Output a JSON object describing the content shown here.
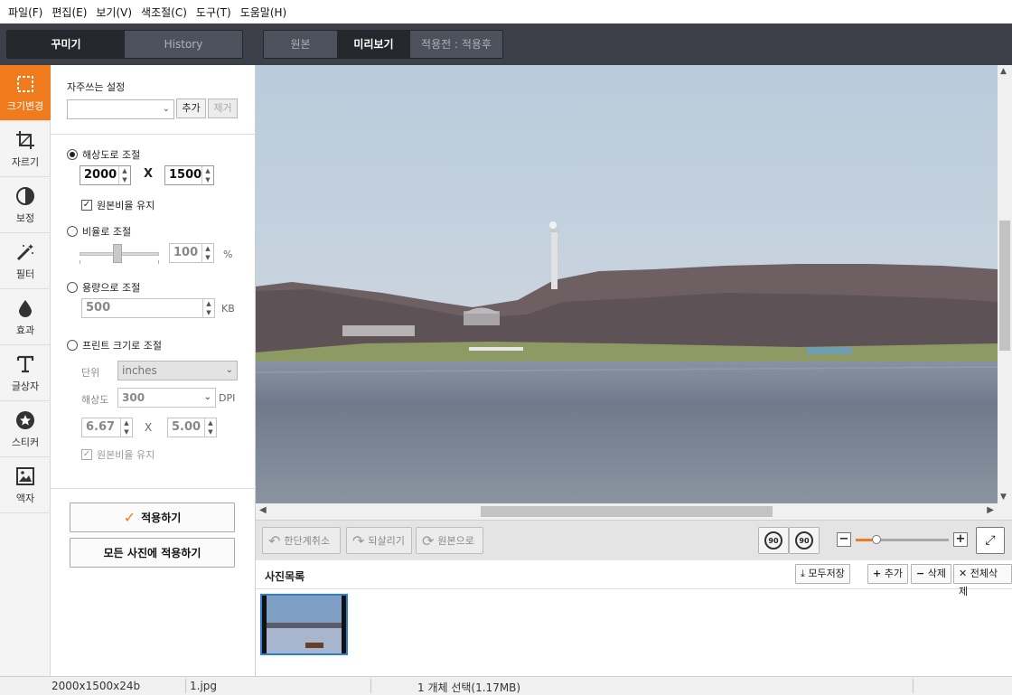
{
  "menu": [
    "파일(F)",
    "편집(E)",
    "보기(V)",
    "색조절(C)",
    "도구(T)",
    "도움말(H)"
  ],
  "left_tabs": [
    "꾸미기",
    "History"
  ],
  "view_tabs": [
    "원본",
    "미리보기",
    "적용전 : 적용후"
  ],
  "tools": [
    "크기변경",
    "자르기",
    "보정",
    "필터",
    "효과",
    "글상자",
    "스티커",
    "액자"
  ],
  "panel": {
    "favorites_title": "자주쓰는 설정",
    "favorites_value": "",
    "add_label": "추가",
    "remove_label": "제거",
    "resolution_label": "해상도로 조절",
    "width": "2000",
    "height": "1500",
    "x_label": "X",
    "keep_ratio_label": "원본비율 유지",
    "ratio_label": "비율로 조절",
    "ratio_value": "100",
    "ratio_unit": "%",
    "size_label": "용량으로 조절",
    "size_value": "500",
    "size_unit": "KB",
    "print_label": "프린트 크기로 조절",
    "unit_label": "단위",
    "unit_value": "inches",
    "dpi_label": "해상도",
    "dpi_value": "300",
    "dpi_unit": "DPI",
    "print_w": "6.67",
    "print_h": "5.00",
    "print_x": "X",
    "print_keep_ratio": "원본비율 유지",
    "apply_label": "적용하기",
    "apply_all_label": "모든 사진에 적용하기"
  },
  "toolbar": {
    "undo_label": "한단계취소",
    "redo_label": "되살리기",
    "revert_label": "원본으로",
    "rotate_left": "90",
    "rotate_right": "90",
    "zoom_level": 0.22
  },
  "photo_list": {
    "title": "사진목록",
    "save_all": "모두저장",
    "add": "추가",
    "delete": "삭제",
    "delete_all": "전체삭제"
  },
  "status": {
    "dimensions": "2000x1500x24b",
    "filename": "1.jpg",
    "selection": "1 개체 선택(1.17MB)"
  },
  "colors": {
    "accent": "#f07b1d",
    "dark_bar": "#3d4049",
    "thumb_border": "#2d80d2"
  }
}
